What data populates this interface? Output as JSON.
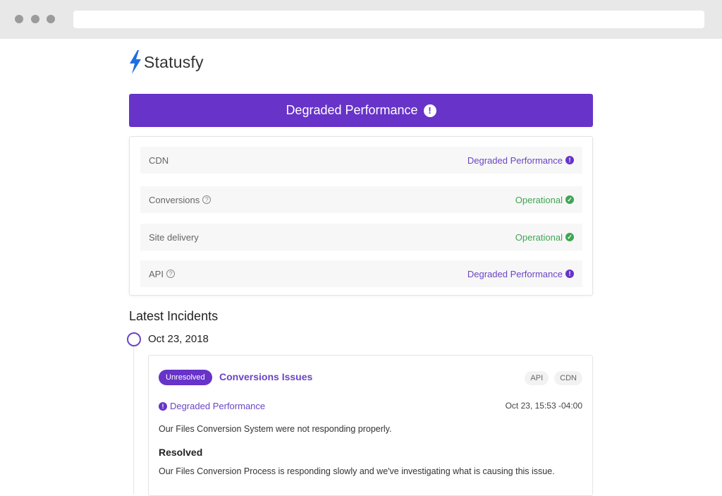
{
  "browser": {
    "url": ""
  },
  "logo": {
    "name": "Statusfy",
    "icon": "lightning-bolt-icon"
  },
  "banner": {
    "label": "Degraded Performance",
    "icon": "exclamation-circle-icon"
  },
  "components": [
    {
      "name": "CDN",
      "help": false,
      "status": "Degraded Performance",
      "state": "degraded"
    },
    {
      "name": "Conversions",
      "help": true,
      "status": "Operational",
      "state": "operational"
    },
    {
      "name": "Site delivery",
      "help": false,
      "status": "Operational",
      "state": "operational"
    },
    {
      "name": "API",
      "help": true,
      "status": "Degraded Performance",
      "state": "degraded"
    }
  ],
  "colors": {
    "brand": "#6733c9",
    "degraded": "#6a45c4",
    "operational": "#3fa653"
  },
  "incidents": {
    "section_title": "Latest Incidents",
    "date": "Oct 23, 2018",
    "items": [
      {
        "badge": "Unresolved",
        "title": "Conversions Issues",
        "tags": [
          "API",
          "CDN"
        ],
        "status": "Degraded Performance",
        "time": "Oct 23, 15:53 -04:00",
        "description": "Our Files Conversion System were not responding properly.",
        "update_title": "Resolved",
        "update_description": "Our Files Conversion Process is responding slowly and we've investigating what is causing this issue."
      }
    ]
  }
}
